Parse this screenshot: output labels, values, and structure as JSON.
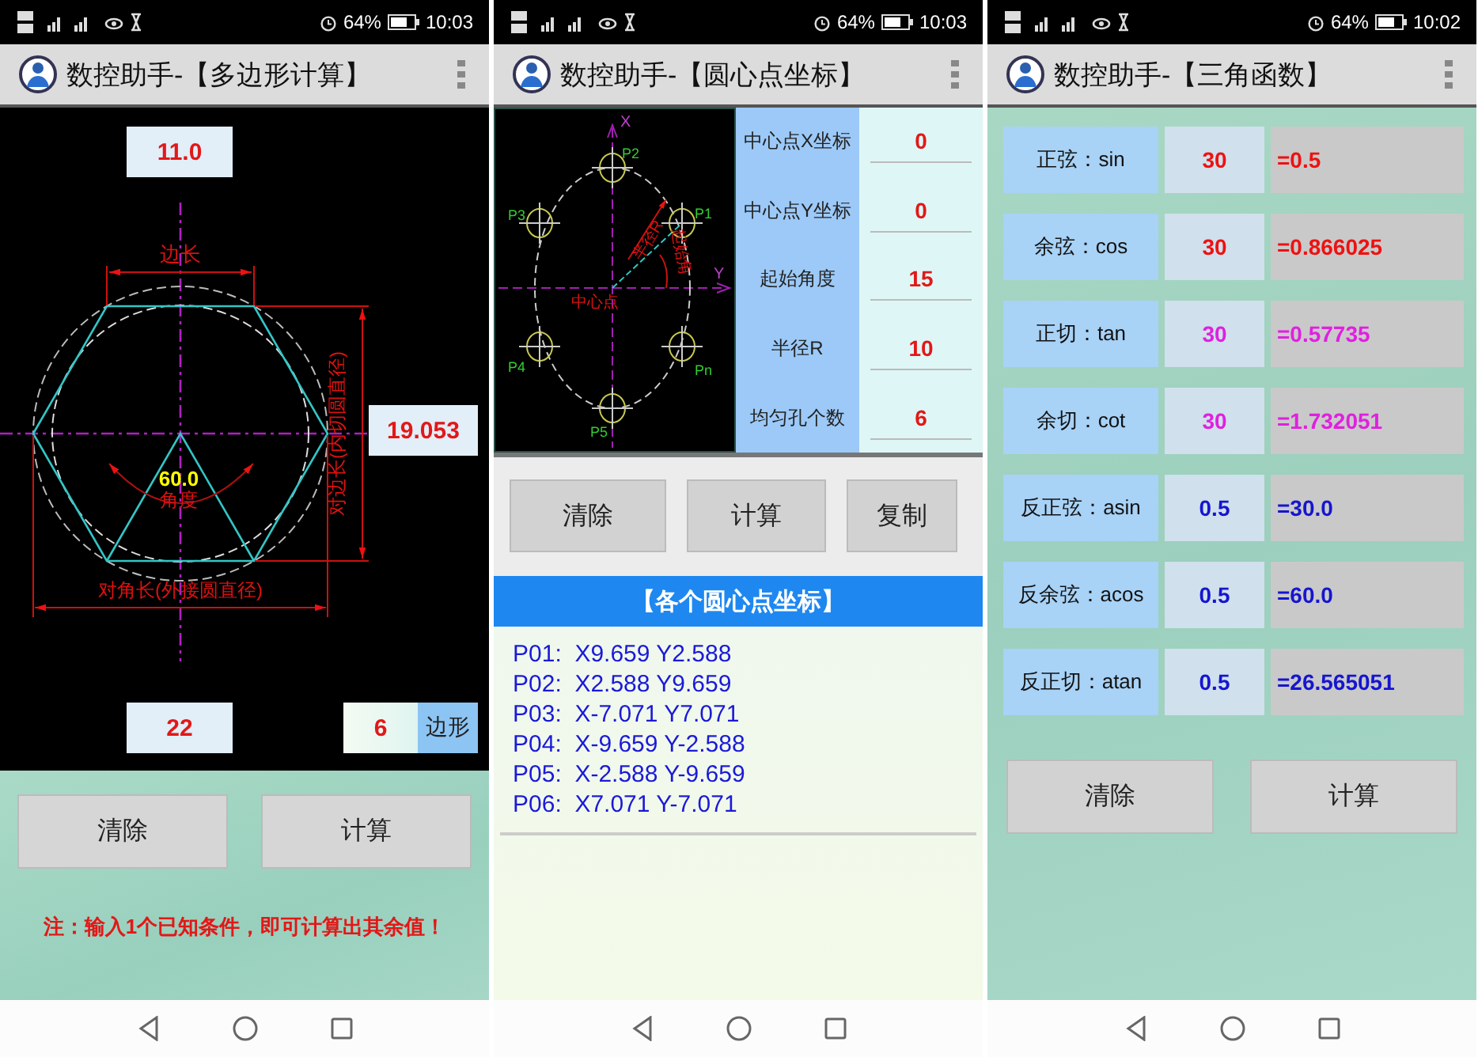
{
  "screens": [
    {
      "kind": "polygon",
      "status_bar": {
        "battery": "64%",
        "time": "10:03"
      },
      "title": "数控助手-【多边形计算】",
      "diagram": {
        "side_label": "边长",
        "angle_value": "60.0",
        "angle_label": "角度",
        "flat_label": "对边长(内切圆直径)",
        "diagonal_label": "对角长(外接圆直径)"
      },
      "side_length": "11.0",
      "across_flats": "19.053",
      "across_corners": "22",
      "sides": "6",
      "sides_unit": "边形",
      "buttons": [
        "清除",
        "计算"
      ],
      "note": "注：输入1个已知条件，即可计算出其余值！"
    },
    {
      "kind": "bolt_circle",
      "status_bar": {
        "battery": "64%",
        "time": "10:03"
      },
      "title": "数控助手-【圆心点坐标】",
      "diagram": {
        "x_axis": "X",
        "y_axis": "Y",
        "points": [
          "P1",
          "P2",
          "P3",
          "P4",
          "P5",
          "Pn"
        ],
        "center_label": "中心点",
        "radius_label": "半径R",
        "angle_label": "起始角"
      },
      "fields": [
        {
          "label": "中心点X坐标",
          "value": "0"
        },
        {
          "label": "中心点Y坐标",
          "value": "0"
        },
        {
          "label": "起始角度",
          "value": "15"
        },
        {
          "label": "半径R",
          "value": "10"
        },
        {
          "label": "均匀孔个数",
          "value": "6"
        }
      ],
      "buttons": [
        "清除",
        "计算",
        "复制"
      ],
      "results_title": "【各个圆心点坐标】",
      "results": [
        "P01:  X9.659 Y2.588",
        "P02:  X2.588 Y9.659",
        "P03:  X-7.071 Y7.071",
        "P04:  X-9.659 Y-2.588",
        "P05:  X-2.588 Y-9.659",
        "P06:  X7.071 Y-7.071"
      ]
    },
    {
      "kind": "trig",
      "status_bar": {
        "battery": "64%",
        "time": "10:02"
      },
      "title": "数控助手-【三角函数】",
      "rows": [
        {
          "label": "正弦：sin",
          "input": "30",
          "result": "=0.5",
          "color": "#ee1111"
        },
        {
          "label": "余弦：cos",
          "input": "30",
          "result": "=0.866025",
          "color": "#ee1111"
        },
        {
          "label": "正切：tan",
          "input": "30",
          "result": "=0.57735",
          "color": "#e020e0"
        },
        {
          "label": "余切：cot",
          "input": "30",
          "result": "=1.732051",
          "color": "#e020e0"
        },
        {
          "label": "反正弦：asin",
          "input": "0.5",
          "result": "=30.0",
          "color": "#1515d0"
        },
        {
          "label": "反余弦：acos",
          "input": "0.5",
          "result": "=60.0",
          "color": "#1515d0"
        },
        {
          "label": "反正切：atan",
          "input": "0.5",
          "result": "=26.565051",
          "color": "#1515d0"
        }
      ],
      "buttons": [
        "清除",
        "计算"
      ]
    }
  ]
}
